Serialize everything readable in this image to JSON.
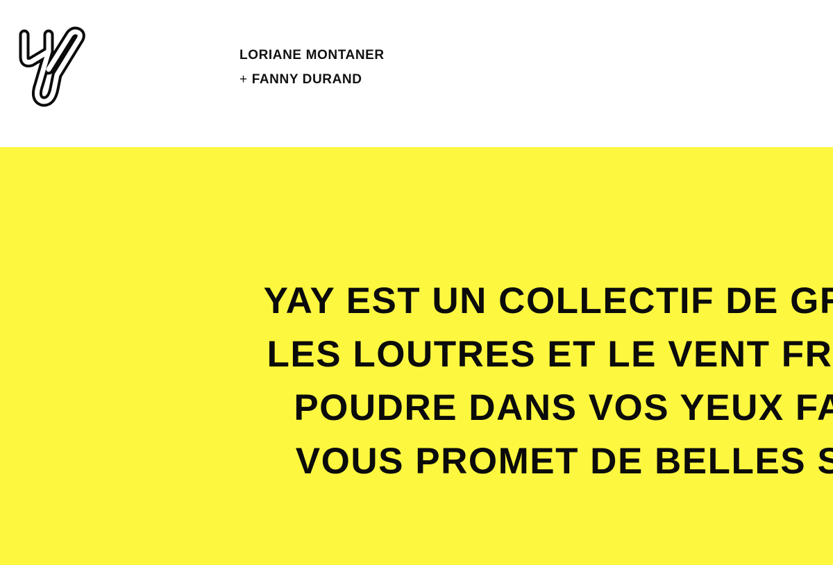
{
  "header": {
    "logo_name": "yay-logo",
    "names": {
      "first": "LORIANE MONTANER",
      "plus": "+",
      "second": "FANNY DURAND"
    }
  },
  "hero": {
    "background_color": "#fdf83f",
    "tagline_lines": [
      "YAY EST UN COLLECTIF DE GRA",
      "LES LOUTRES ET LE VENT FRAI",
      "POUDRE DANS VOS YEUX FA",
      "VOUS PROMET DE BELLES S"
    ]
  }
}
